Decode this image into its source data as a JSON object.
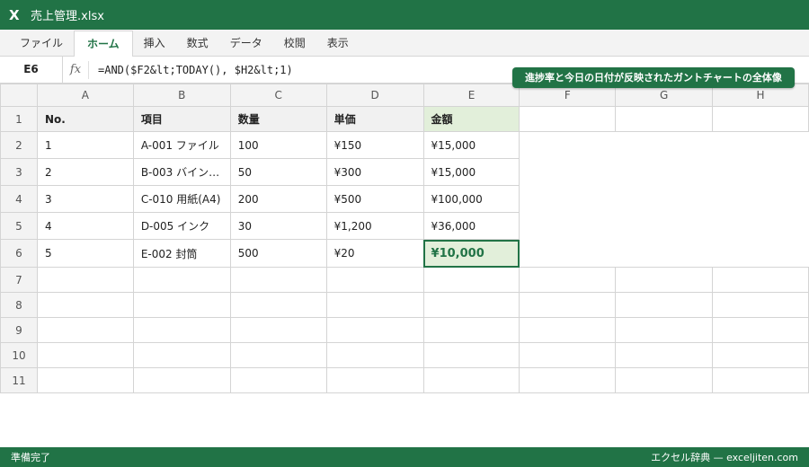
{
  "window": {
    "app_icon": "X",
    "title": "売上管理.xlsx"
  },
  "ribbon": {
    "tabs": [
      {
        "label": "ファイル"
      },
      {
        "label": "ホーム"
      },
      {
        "label": "挿入"
      },
      {
        "label": "数式"
      },
      {
        "label": "データ"
      },
      {
        "label": "校閲"
      },
      {
        "label": "表示"
      }
    ],
    "active": "ホーム"
  },
  "formula_bar": {
    "cell_ref": "E6",
    "fx": "fx",
    "formula": "=AND($F2&lt;TODAY(), $H2&lt;1)"
  },
  "callout": "進捗率と今日の日付が反映されたガントチャートの全体像",
  "grid": {
    "columns": [
      "A",
      "B",
      "C",
      "D",
      "E",
      "F",
      "G",
      "H"
    ],
    "header_row": {
      "num": "1",
      "cells": [
        "No.",
        "項目",
        "数量",
        "単価",
        "金額"
      ]
    },
    "data_rows": [
      {
        "num": "2",
        "cells": [
          "1",
          "A-001 ファイル",
          "100",
          "¥150",
          "¥15,000"
        ]
      },
      {
        "num": "3",
        "cells": [
          "2",
          "B-003 バイン…",
          "50",
          "¥300",
          "¥15,000"
        ]
      },
      {
        "num": "4",
        "cells": [
          "3",
          "C-010 用紙(A4)",
          "200",
          "¥500",
          "¥100,000"
        ]
      },
      {
        "num": "5",
        "cells": [
          "4",
          "D-005 インク",
          "30",
          "¥1,200",
          "¥36,000"
        ]
      },
      {
        "num": "6",
        "cells": [
          "5",
          "E-002 封筒",
          "500",
          "¥20",
          "¥10,000"
        ]
      }
    ],
    "empty_rows": [
      "7",
      "8",
      "9",
      "10",
      "11"
    ]
  },
  "status": {
    "left": "準備完了",
    "right": "エクセル辞典 — exceljiten.com"
  },
  "colors": {
    "accent": "#217346",
    "selected_fill": "#e2efda"
  }
}
